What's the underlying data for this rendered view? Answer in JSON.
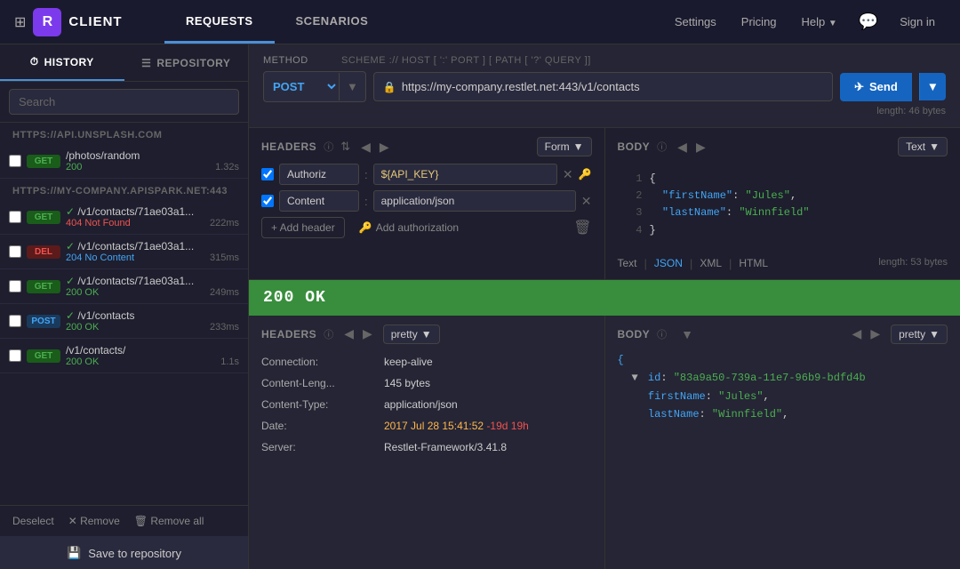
{
  "topnav": {
    "grid_icon": "⊞",
    "logo_letter": "R",
    "app_name": "CLIENT",
    "tabs": [
      {
        "id": "requests",
        "label": "REQUESTS",
        "active": true
      },
      {
        "id": "scenarios",
        "label": "SCENARIOS",
        "active": false
      }
    ],
    "settings_label": "Settings",
    "pricing_label": "Pricing",
    "help_label": "Help",
    "chat_icon": "💬",
    "signin_label": "Sign in"
  },
  "sidebar": {
    "history_tab": "HISTORY",
    "repository_tab": "REPOSITORY",
    "history_icon": "⏱",
    "repository_icon": "☰",
    "search_placeholder": "Search",
    "group1_label": "HTTPS://API.UNSPLASH.COM",
    "group2_label": "HTTPS://MY-COMPANY.APISPARK.NET:443",
    "items": [
      {
        "method": "GET",
        "path": "/photos/random",
        "status": "200",
        "time": "1.32s",
        "status_class": "status-200"
      },
      {
        "method": "GET",
        "path": "/v1/contacts/71ae03a1...",
        "status": "404 Not Found",
        "time": "222ms",
        "status_class": "status-404"
      },
      {
        "method": "DEL",
        "path": "/v1/contacts/71ae03a1...",
        "status": "204 No Content",
        "time": "315ms",
        "status_class": "status-204"
      },
      {
        "method": "GET",
        "path": "/v1/contacts/71ae03a1...",
        "status": "200 OK",
        "time": "249ms",
        "status_class": "status-200"
      },
      {
        "method": "POST",
        "path": "/v1/contacts",
        "status": "200 OK",
        "time": "233ms",
        "status_class": "status-200"
      },
      {
        "method": "GET",
        "path": "/v1/contacts/",
        "status": "200 OK",
        "time": "1.1s",
        "status_class": "status-200"
      }
    ],
    "deselect_label": "Deselect",
    "remove_label": "✕ Remove",
    "remove_all_label": "🗑 Remove all",
    "save_repo_label": "Save to repository",
    "save_icon": "💾"
  },
  "request": {
    "method_label": "METHOD",
    "scheme_label": "SCHEME :// HOST [ ':' PORT ] [ PATH [ '?' QUERY ]]",
    "method": "POST",
    "url": "https://my-company.restlet.net:443/v1/contacts",
    "url_length": "length: 46 bytes",
    "lock_icon": "🔒",
    "send_label": "Send",
    "send_icon": "✈"
  },
  "headers_panel": {
    "title": "HEADERS",
    "format_label": "Form",
    "rows": [
      {
        "checked": true,
        "key": "Authoriz",
        "value": "${API_KEY}"
      },
      {
        "checked": true,
        "key": "Content",
        "value": "application/json"
      }
    ],
    "add_header_label": "+ Add header",
    "add_auth_label": "Add authorization",
    "add_auth_icon": "🔑"
  },
  "body_panel": {
    "title": "BODY",
    "format_label": "Text",
    "code_lines": [
      {
        "no": 1,
        "content": "{"
      },
      {
        "no": 2,
        "content": "  \"firstName\": \"Jules\","
      },
      {
        "no": 3,
        "content": "  \"lastName\": \"Winnfield\""
      },
      {
        "no": 4,
        "content": "}"
      }
    ],
    "length": "length: 53 bytes",
    "format_tabs": [
      "Text",
      "JSON",
      "XML",
      "HTML"
    ],
    "active_format": "JSON"
  },
  "response": {
    "status": "200 OK",
    "headers_title": "HEADERS",
    "body_title": "BODY",
    "pretty_label": "pretty",
    "headers": [
      {
        "key": "Connection:",
        "value": "keep-alive",
        "highlight": false
      },
      {
        "key": "Content-Leng...",
        "value": "145 bytes",
        "highlight": false
      },
      {
        "key": "Content-Type:",
        "value": "application/json",
        "highlight": false
      },
      {
        "key": "Date:",
        "value": "2017 Jul 28 15:41:52 -19d 19h",
        "highlight": true
      },
      {
        "key": "Server:",
        "value": "Restlet-Framework/3.41.8",
        "highlight": false
      }
    ],
    "body_json": {
      "id_key": "id",
      "id_value": "83a9a50-739a-11e7-96b9-bdfd4b",
      "firstName_key": "firstName",
      "firstName_value": "Jules",
      "lastName_key": "lastName",
      "lastName_value": "Winnfield"
    }
  }
}
